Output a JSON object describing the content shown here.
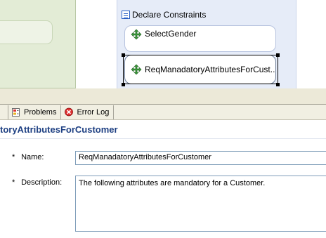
{
  "diagram": {
    "container_title": "Declare Constraints",
    "constraints": [
      {
        "label": "SelectGender"
      },
      {
        "label": "ReqManadatoryAttributesForCust..."
      }
    ]
  },
  "tabs": [
    {
      "label": "Problems",
      "icon": "problems-icon"
    },
    {
      "label": "Error Log",
      "icon": "error-log-icon"
    }
  ],
  "properties": {
    "header": "toryAttributesForCustomer",
    "name_label": "Name:",
    "name_value": "ReqManadatoryAttributesForCustomer",
    "description_label": "Description:",
    "description_value": "The following attributes are mandatory for a Customer.",
    "required_marker": "*"
  },
  "colors": {
    "accent": "#1d3f82",
    "lane_green": "#e3ecd6",
    "container_blue": "#e6ecf8"
  }
}
